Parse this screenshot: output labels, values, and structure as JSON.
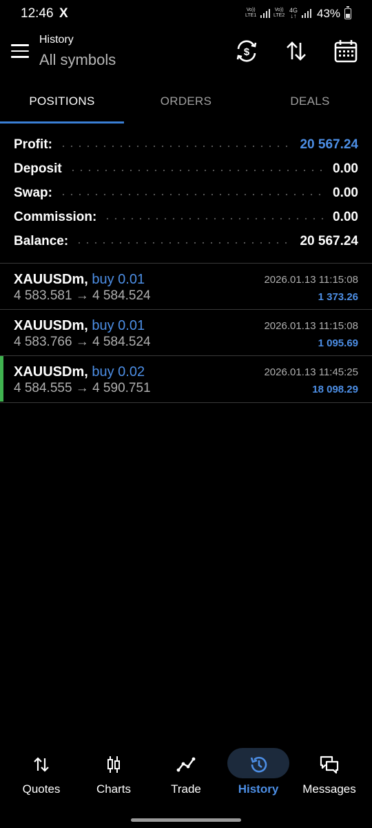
{
  "status_bar": {
    "time": "12:46",
    "x_logo": "X",
    "sim1": "Vo)) LTE1",
    "sim2": "Vo)) LTE2",
    "net_type": "4G",
    "battery": "43%"
  },
  "header": {
    "title": "History",
    "subtitle": "All symbols"
  },
  "tabs": [
    {
      "label": "POSITIONS",
      "active": true
    },
    {
      "label": "ORDERS",
      "active": false
    },
    {
      "label": "DEALS",
      "active": false
    }
  ],
  "summary": [
    {
      "label": "Profit:",
      "value": "20 567.24",
      "highlight": true
    },
    {
      "label": "Deposit",
      "value": "0.00",
      "highlight": false
    },
    {
      "label": "Swap:",
      "value": "0.00",
      "highlight": false
    },
    {
      "label": "Commission:",
      "value": "0.00",
      "highlight": false
    },
    {
      "label": "Balance:",
      "value": "20 567.24",
      "highlight": false
    }
  ],
  "deals": [
    {
      "symbol": "XAUUSDm,",
      "action": "buy 0.01",
      "prices": "4 583.581 → 4 584.524",
      "time": "2026.01.13 11:15:08",
      "profit": "1 373.26"
    },
    {
      "symbol": "XAUUSDm,",
      "action": "buy 0.01",
      "prices": "4 583.766 → 4 584.524",
      "time": "2026.01.13 11:15:08",
      "profit": "1 095.69"
    },
    {
      "symbol": "XAUUSDm,",
      "action": "buy 0.02",
      "prices": "4 584.555 → 4 590.751",
      "time": "2026.01.13 11:45:25",
      "profit": "18 098.29"
    }
  ],
  "nav": [
    {
      "label": "Quotes",
      "icon": "quotes-icon"
    },
    {
      "label": "Charts",
      "icon": "charts-icon"
    },
    {
      "label": "Trade",
      "icon": "trade-icon"
    },
    {
      "label": "History",
      "icon": "history-icon",
      "active": true
    },
    {
      "label": "Messages",
      "icon": "messages-icon"
    }
  ],
  "colors": {
    "accent": "#4d8fe6",
    "tab_underline": "#3a7fd5",
    "marker": "#3fb24f",
    "background": "#000000"
  }
}
